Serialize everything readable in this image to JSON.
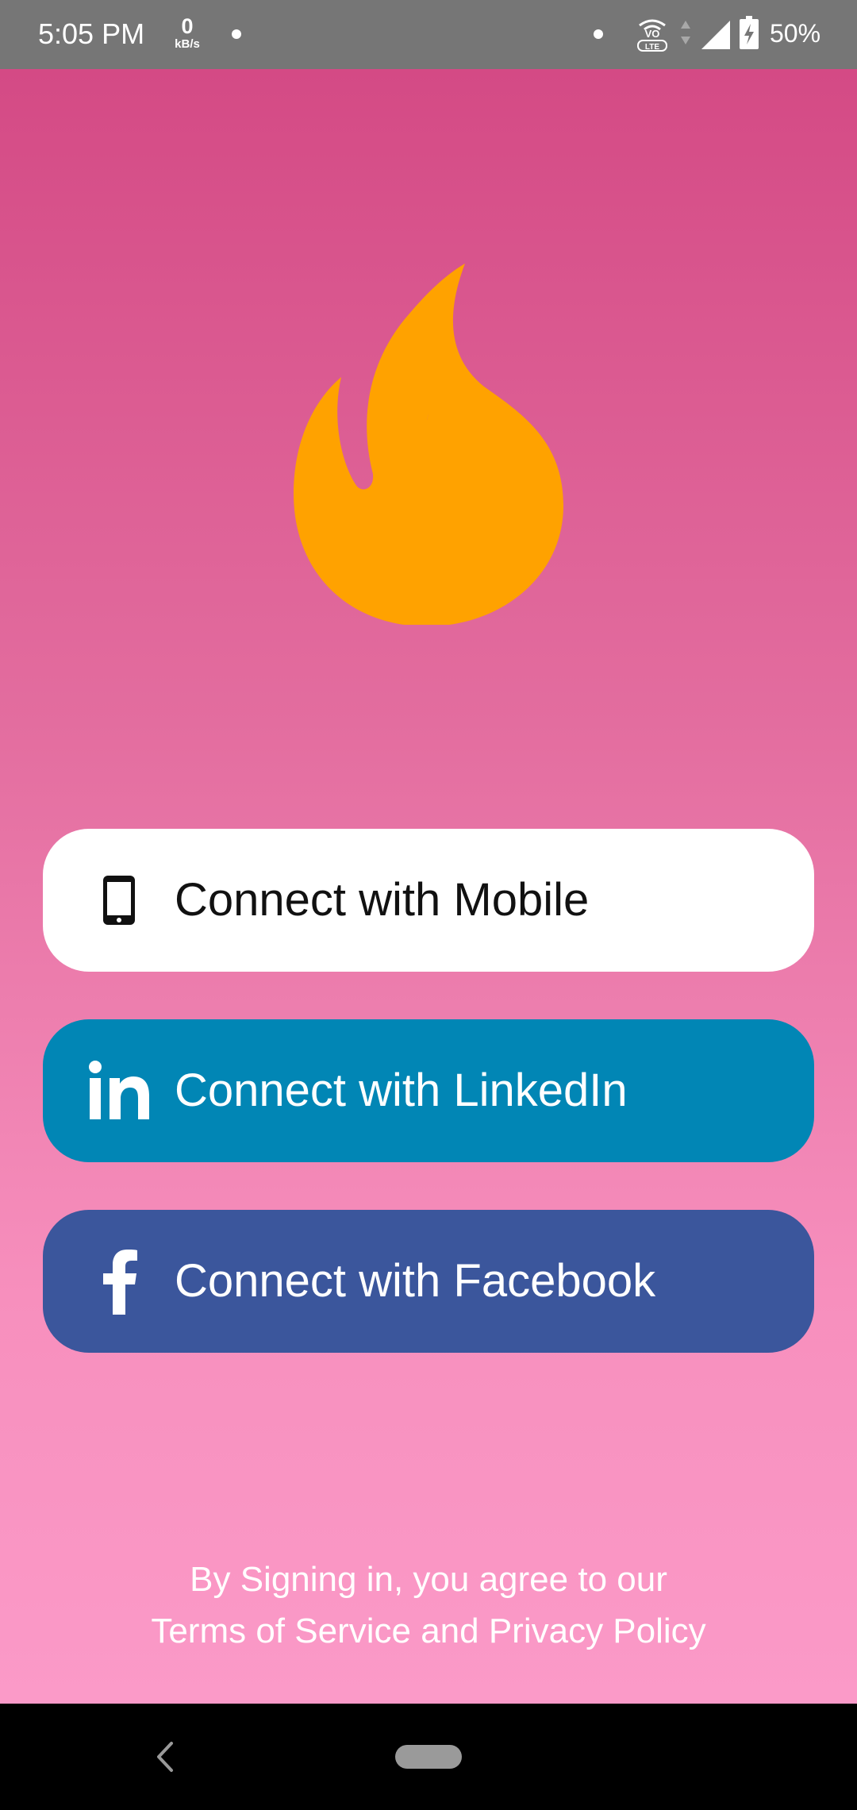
{
  "status_bar": {
    "time": "5:05 PM",
    "speed_value": "0",
    "speed_unit": "kB/s",
    "volte_label": "VO LTE",
    "battery": "50%"
  },
  "app": {
    "logo": "flame-logo",
    "colors": {
      "gradient_top": "#d44a85",
      "gradient_bottom": "#fb9ac8",
      "flame": "#ffa200",
      "linkedin": "#0186b5",
      "facebook": "#3b569c"
    }
  },
  "buttons": {
    "mobile": {
      "label": "Connect with Mobile",
      "icon": "phone-icon"
    },
    "linkedin": {
      "label": "Connect with LinkedIn",
      "icon": "linkedin-icon"
    },
    "facebook": {
      "label": "Connect with Facebook",
      "icon": "facebook-icon"
    }
  },
  "footer": {
    "line1": "By Signing in, you agree to our",
    "line2": "Terms of Service and Privacy Policy"
  },
  "nav": {
    "back_icon": "back-icon",
    "home_icon": "home-pill-icon"
  }
}
